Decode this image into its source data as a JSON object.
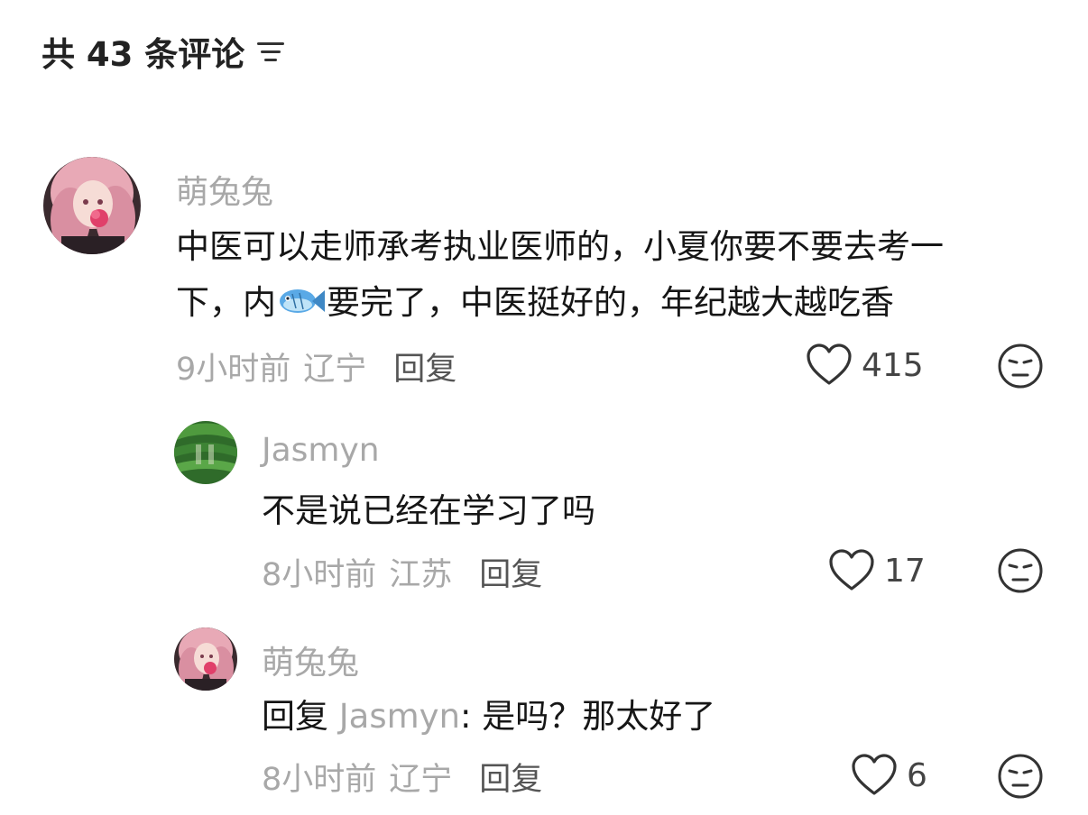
{
  "header": {
    "title": "共 43 条评论"
  },
  "comments": [
    {
      "username": "萌兔兔",
      "line1": "中医可以走师承考执业医师的，小夏你要不要去考一",
      "line2_pre": "下，内",
      "line2_post": "要完了，中医挺好的，年纪越大越吃香",
      "time": "9小时前",
      "location": "辽宁",
      "reply_label": "回复",
      "likes": "415"
    },
    {
      "username": "Jasmyn",
      "text": "不是说已经在学习了吗",
      "time": "8小时前",
      "location": "江苏",
      "reply_label": "回复",
      "likes": "17"
    },
    {
      "username": "萌兔兔",
      "reply_prefix": "回复",
      "reply_target": "Jasmyn",
      "text": ": 是吗？那太好了",
      "time": "8小时前",
      "location": "辽宁",
      "reply_label": "回复",
      "likes": "6"
    }
  ]
}
